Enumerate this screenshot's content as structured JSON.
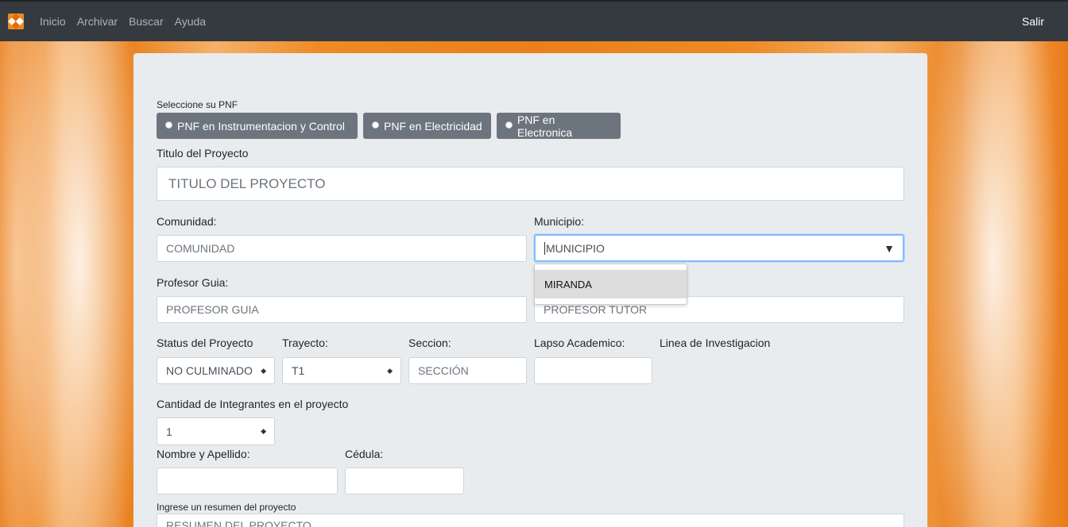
{
  "nav": {
    "brand_icon": "logo-icon",
    "links": [
      "Inicio",
      "Archivar",
      "Buscar",
      "Ayuda"
    ],
    "logout": "Salir"
  },
  "form": {
    "pnf_label": "Seleccione su PNF",
    "pnf_options": [
      "PNF en Instrumentacion y Control",
      "PNF en Electricidad",
      "PNF en Electronica"
    ],
    "titulo_label": "Titulo del Proyecto",
    "titulo_placeholder": "TITULO DEL PROYECTO",
    "comunidad_label": "Comunidad:",
    "comunidad_placeholder": "COMUNIDAD",
    "municipio_label": "Municipio:",
    "municipio_value": "MUNICIPIO",
    "municipio_options": [
      "MIRANDA"
    ],
    "profesor_guia_label": "Profesor Guia:",
    "profesor_guia_placeholder": "PROFESOR GUIA",
    "profesor_tutor_placeholder": "PROFESOR TUTOR",
    "status_label": "Status del Proyecto",
    "status_value": "NO CULMINADO",
    "trayecto_label": "Trayecto:",
    "trayecto_value": "T1",
    "seccion_label": "Seccion:",
    "seccion_placeholder": "SECCIÓN",
    "lapso_label": "Lapso Academico:",
    "linea_label": "Linea de Investigacion",
    "cantidad_label": "Cantidad de Integrantes en el proyecto",
    "cantidad_value": "1",
    "nombre_label": "Nombre y Apellido:",
    "cedula_label": "Cédula:",
    "resumen_label": "Ingrese un resumen del proyecto",
    "resumen_placeholder": "RESUMEN DEL PROYECTO"
  }
}
